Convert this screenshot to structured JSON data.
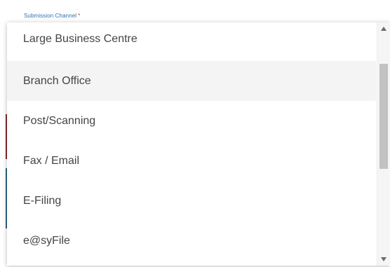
{
  "field": {
    "label": "Submission Channel",
    "required_marker": "*"
  },
  "dropdown": {
    "options": [
      {
        "label": "Large Business Centre"
      },
      {
        "label": "Branch Office"
      },
      {
        "label": "Post/Scanning"
      },
      {
        "label": "Fax / Email"
      },
      {
        "label": "E-Filing"
      },
      {
        "label": "e@syFile"
      }
    ],
    "highlighted_option": "Branch Office"
  },
  "colors": {
    "label": "#2f6fb1",
    "required": "#d9342b",
    "option_text": "#444444",
    "highlight_bg": "#f4f4f4",
    "scrollbar_thumb": "#c2c2c2"
  },
  "icons": {
    "scroll_up": "triangle-up-icon",
    "scroll_down": "triangle-down-icon"
  }
}
